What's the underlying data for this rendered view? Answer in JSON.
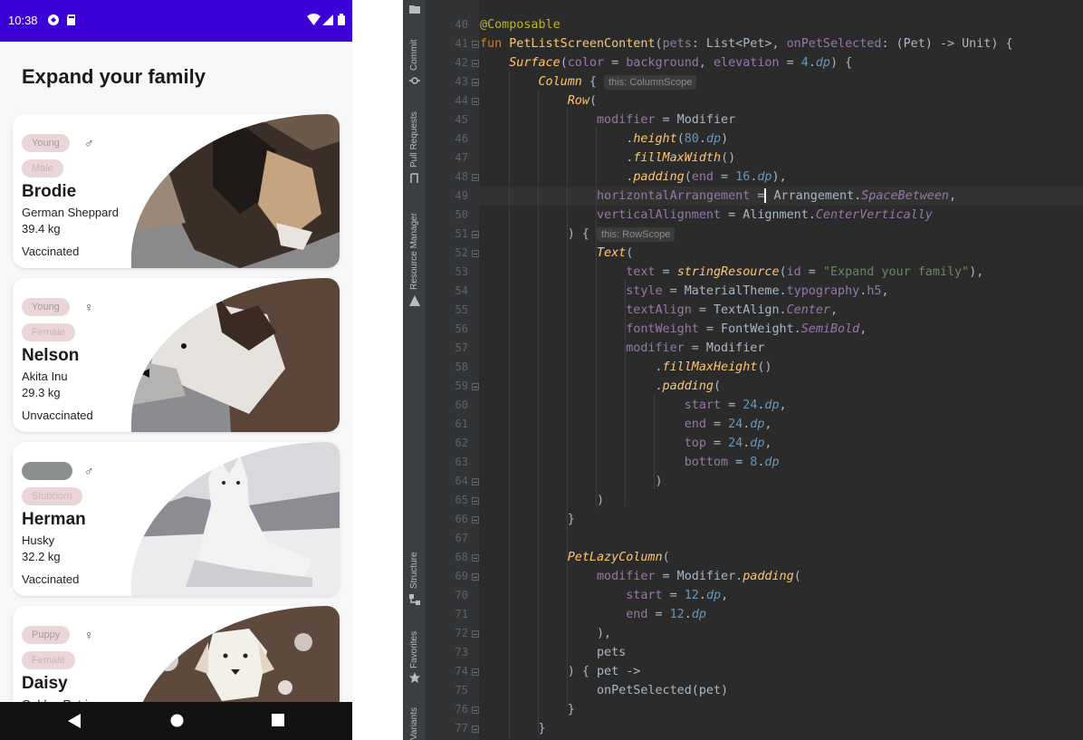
{
  "phone": {
    "status_time": "10:38",
    "title": "Expand your family",
    "pets": [
      {
        "age": "Young",
        "gender_symbol": "♂",
        "gender_chip": "Male",
        "name": "Brodie",
        "breed": "German Sheppard",
        "weight": "39.4 kg",
        "vaccination": "Vaccinated"
      },
      {
        "age": "Young",
        "gender_symbol": "♀",
        "gender_chip": "Female",
        "name": "Nelson",
        "breed": "Akita Inu",
        "weight": "29.3 kg",
        "vaccination": "Unvaccinated"
      },
      {
        "age": "",
        "gender_symbol": "♂",
        "gender_chip": "Stubborn",
        "name": "Herman",
        "breed": "Husky",
        "weight": "32.2 kg",
        "vaccination": "Vaccinated"
      },
      {
        "age": "Puppy",
        "gender_symbol": "♀",
        "gender_chip": "Female",
        "name": "Daisy",
        "breed": "Golden Retriever",
        "weight": "",
        "vaccination": ""
      }
    ]
  },
  "toolstrip": {
    "tabs": [
      "Commit",
      "Pull Requests",
      "Resource Manager",
      "Structure",
      "Favorites",
      "Variants"
    ]
  },
  "editor": {
    "line_numbers": [
      "40",
      "41",
      "42",
      "43",
      "44",
      "45",
      "46",
      "47",
      "48",
      "49",
      "50",
      "51",
      "52",
      "53",
      "54",
      "55",
      "56",
      "57",
      "58",
      "59",
      "60",
      "61",
      "62",
      "63",
      "64",
      "65",
      "66",
      "67",
      "68",
      "69",
      "70",
      "71",
      "72",
      "73",
      "74",
      "75",
      "76",
      "77"
    ],
    "hints": {
      "column_scope": "this: ColumnScope",
      "row_scope": "this: RowScope"
    }
  },
  "colors": {
    "status_bar": "#3d00d6",
    "editor_bg": "#2b2b2b",
    "keyword": "#cc7832",
    "number": "#6897bb",
    "string": "#6a8759"
  }
}
